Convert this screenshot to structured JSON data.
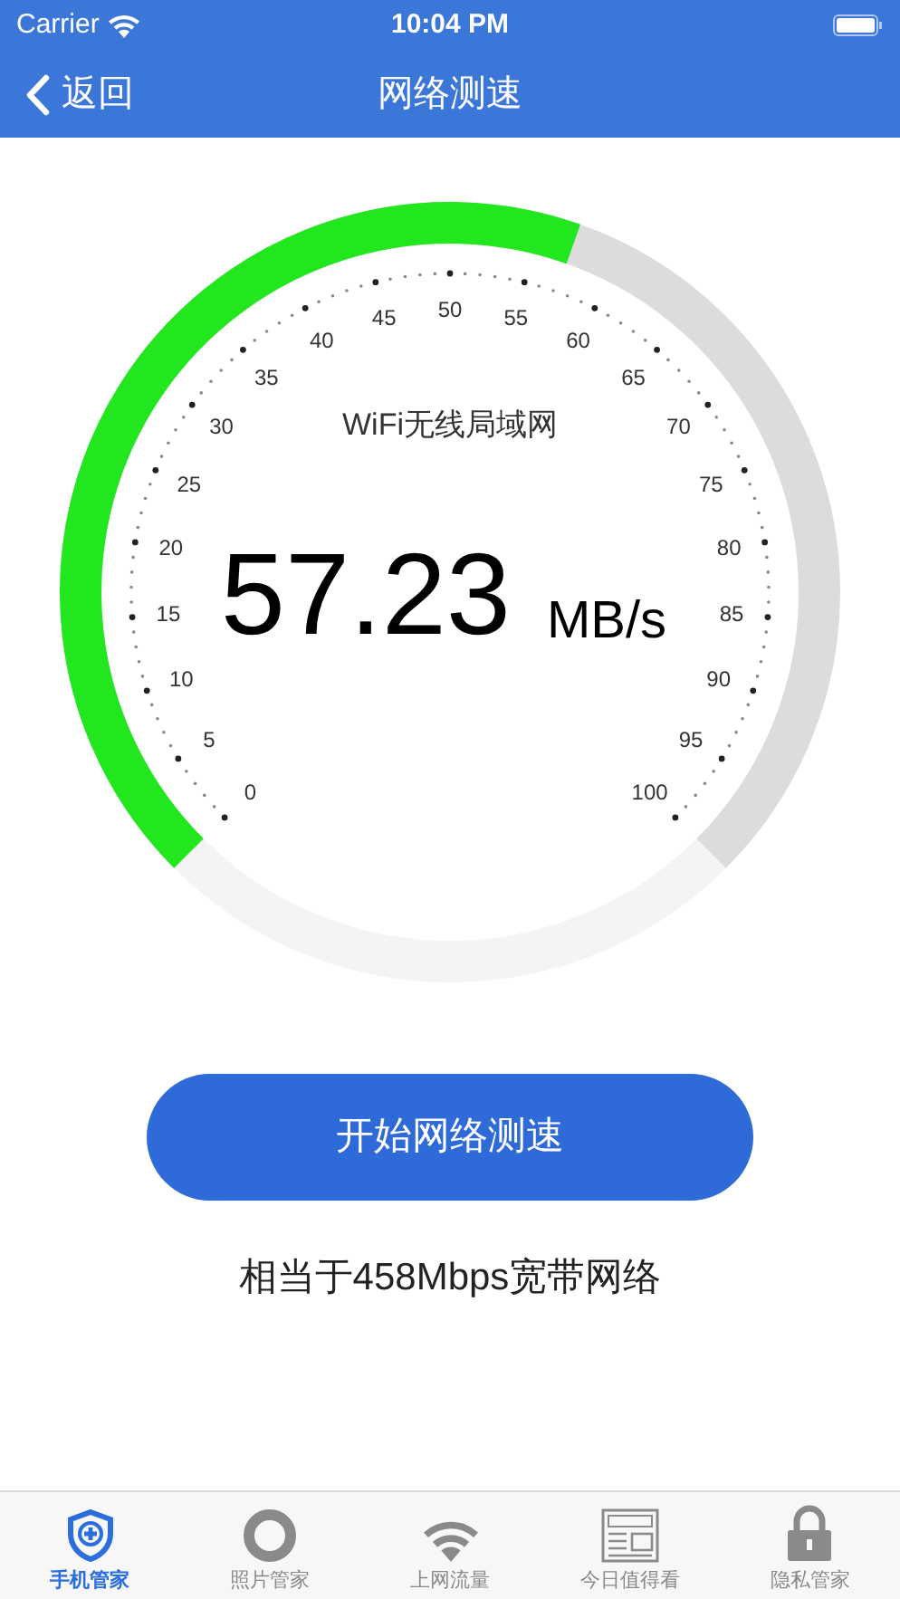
{
  "status_bar": {
    "carrier": "Carrier",
    "time": "10:04 PM"
  },
  "nav_bar": {
    "back_label": "返回",
    "title": "网络测速"
  },
  "gauge": {
    "network": "WiFi无线局域网",
    "value": "57.23",
    "unit": "MB/s",
    "scale_labels": [
      "0",
      "5",
      "10",
      "15",
      "20",
      "25",
      "30",
      "35",
      "40",
      "45",
      "50",
      "55",
      "60",
      "65",
      "70",
      "75",
      "80",
      "85",
      "90",
      "95",
      "100"
    ]
  },
  "start_button": {
    "label": "开始网络测速"
  },
  "equivalent": "相当于458Mbps宽带网络",
  "tabs": [
    {
      "label": "手机管家",
      "selected": true
    },
    {
      "label": "照片管家",
      "selected": false
    },
    {
      "label": "上网流量",
      "selected": false
    },
    {
      "label": "今日值得看",
      "selected": false
    },
    {
      "label": "隐私管家",
      "selected": false
    }
  ]
}
